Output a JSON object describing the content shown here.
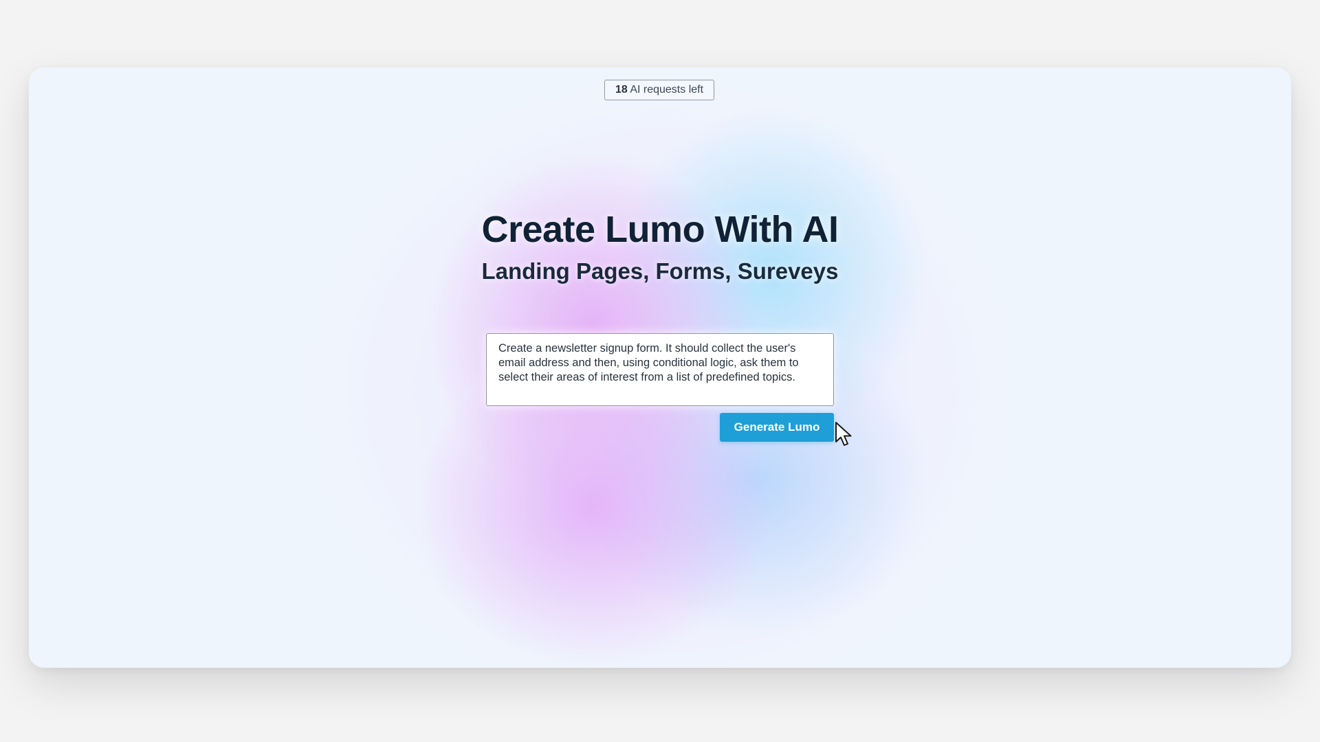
{
  "badge": {
    "count": "18",
    "label": " AI requests left"
  },
  "hero": {
    "title": "Create Lumo With AI",
    "subtitle": "Landing Pages, Forms, Sureveys"
  },
  "prompt": {
    "value": "Create a newsletter signup form. It should collect the user's email address and then, using conditional logic, ask them to select their areas of interest from a list of predefined topics."
  },
  "actions": {
    "generate_label": "Generate Lumo"
  },
  "icons": {
    "cursor": "mouse-pointer-icon"
  },
  "colors": {
    "accent": "#1f9fd8",
    "title": "#112236",
    "card_bg": "#eff5fd"
  }
}
